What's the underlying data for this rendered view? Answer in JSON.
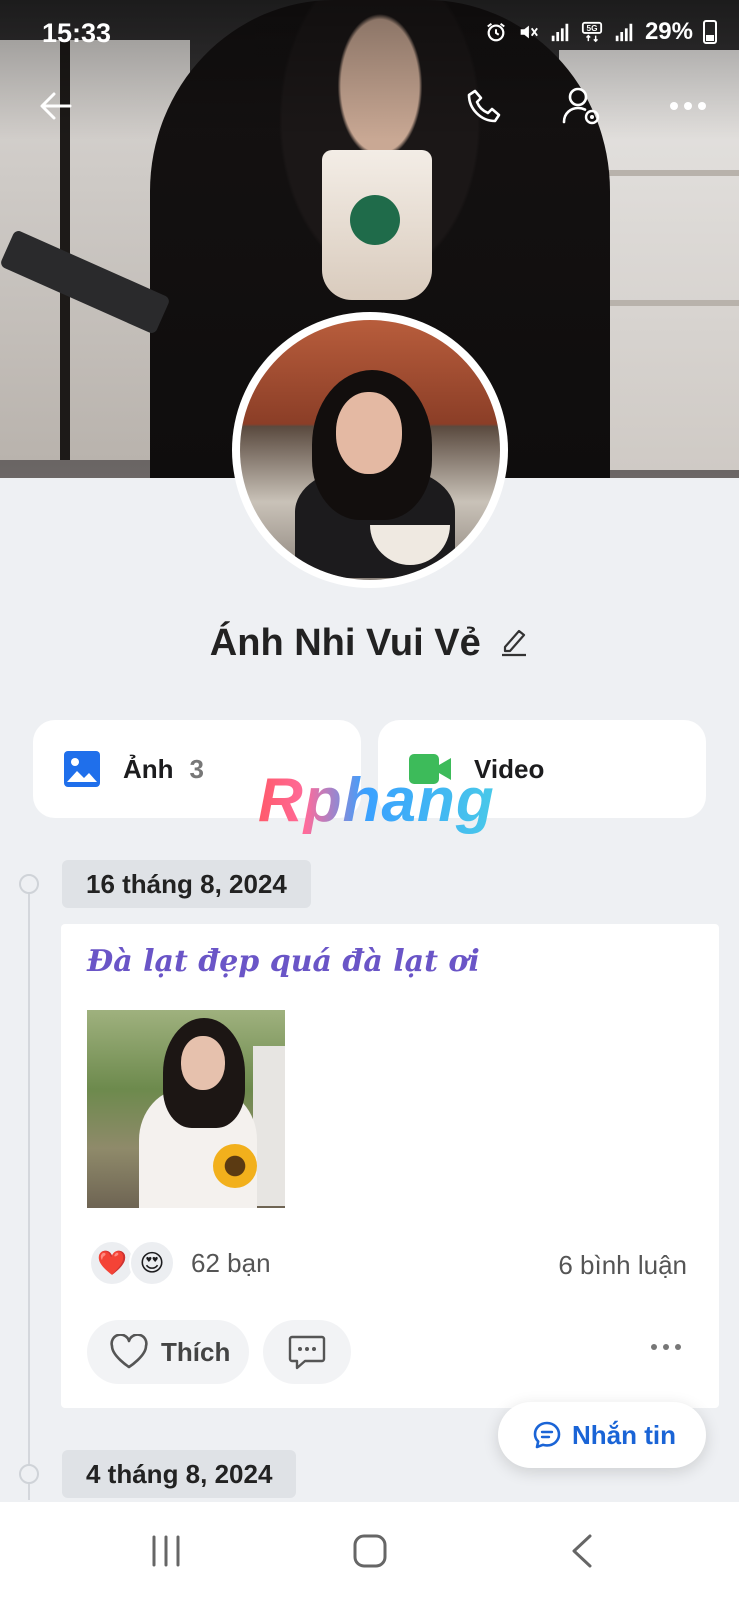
{
  "status_bar": {
    "time": "15:33",
    "battery": "29%",
    "icons": [
      "alarm-icon",
      "mute-icon",
      "signal-icon",
      "5g-icon",
      "signal-icon",
      "battery-icon"
    ]
  },
  "top_nav": {
    "icons": [
      "back-arrow-icon",
      "phone-icon",
      "user-settings-icon",
      "more-icon"
    ]
  },
  "profile": {
    "name": "Ánh Nhi Vui Vẻ"
  },
  "media": {
    "photos_label": "Ảnh",
    "photos_count": "3",
    "video_label": "Video"
  },
  "watermark": "Rphang",
  "timeline": [
    {
      "date": "16 tháng 8, 2024",
      "caption": "Đà lạt đẹp quá đà lạt ơi",
      "reactions": [
        "❤️",
        "😍"
      ],
      "reaction_count": "62 bạn",
      "comment_count": "6 bình luận",
      "like_label": "Thích"
    },
    {
      "date": "4 tháng 8, 2024"
    }
  ],
  "fab": {
    "label": "Nhắn tin"
  },
  "colors": {
    "accent_blue": "#1a64d6",
    "caption_purple": "#6a55c7",
    "video_green": "#3dbb5a",
    "photo_blue": "#1f6feb"
  }
}
